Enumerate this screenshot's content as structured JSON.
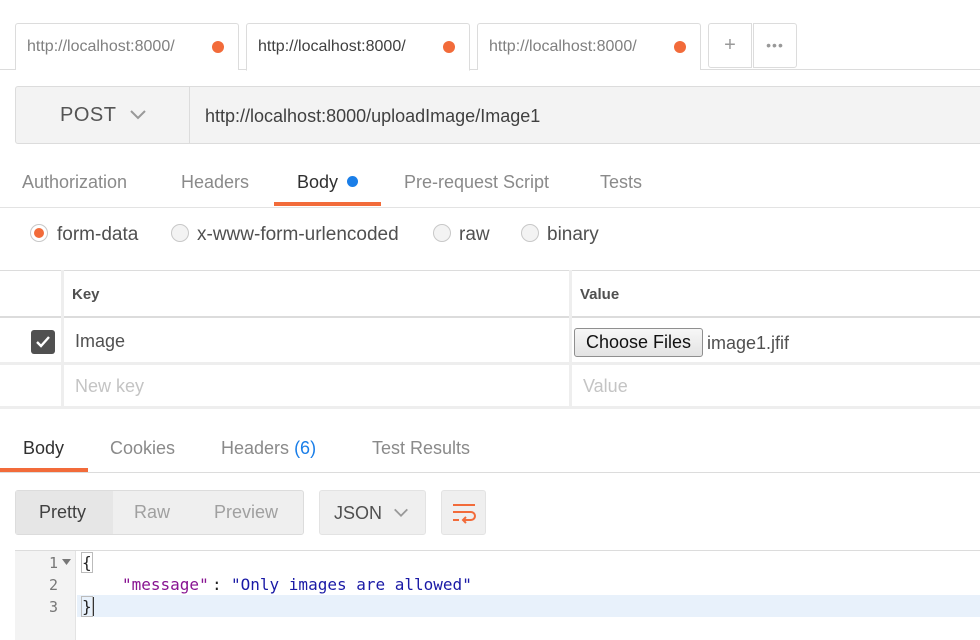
{
  "tabs": [
    {
      "url": "http://localhost:8000/",
      "active": false
    },
    {
      "url": "http://localhost:8000/",
      "active": true
    },
    {
      "url": "http://localhost:8000/",
      "active": false
    }
  ],
  "tab_actions": {
    "add": "+",
    "more": "•••"
  },
  "request": {
    "method": "POST",
    "url": "http://localhost:8000/uploadImage/Image1"
  },
  "request_tabs": [
    "Authorization",
    "Headers",
    "Body",
    "Pre-request Script",
    "Tests"
  ],
  "active_request_tab": "Body",
  "body_modes": [
    "form-data",
    "x-www-form-urlencoded",
    "raw",
    "binary"
  ],
  "selected_body_mode": "form-data",
  "form_table": {
    "headers": {
      "key": "Key",
      "value": "Value"
    },
    "rows": [
      {
        "checked": true,
        "key": "Image",
        "value_button": "Choose Files",
        "value_file": "image1.jfif"
      }
    ],
    "new_row": {
      "key_placeholder": "New key",
      "value_placeholder": "Value"
    }
  },
  "response_tabs": {
    "body": "Body",
    "cookies": "Cookies",
    "headers": "Headers",
    "headers_count": "(6)",
    "test_results": "Test Results"
  },
  "response_view": {
    "modes": [
      "Pretty",
      "Raw",
      "Preview"
    ],
    "active_mode": "Pretty",
    "format": "JSON"
  },
  "response_body": {
    "line_numbers": [
      "1",
      "2",
      "3"
    ],
    "open_brace": "{",
    "key": "\"message\"",
    "colon": ": ",
    "value": "\"Only images are allowed\"",
    "close_brace": "}"
  },
  "colors": {
    "accent": "#f26b3a",
    "blue": "#1a7ee8",
    "json_key": "#881391",
    "json_string": "#1a1aa6"
  }
}
